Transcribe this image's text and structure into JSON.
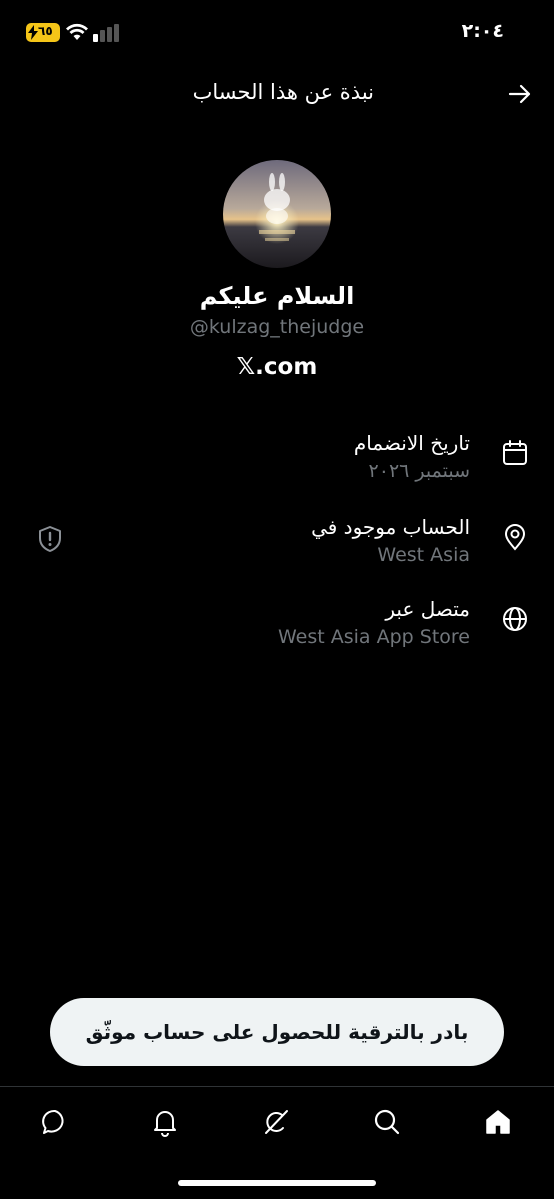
{
  "status_bar": {
    "time": "٢:٠٤",
    "battery_level": "٦٥"
  },
  "header": {
    "title": "نبذة عن هذا الحساب",
    "back_icon": "arrow-right-icon"
  },
  "profile": {
    "display_name": "السلام عليكم",
    "handle": "@kulzag_thejudge",
    "website": "𝕏.com"
  },
  "info": [
    {
      "label": "تاريخ الانضمام",
      "value": "سبتمبر ٢٠٢٦",
      "icon": "calendar-icon"
    },
    {
      "label": "الحساب موجود في",
      "value": "West Asia",
      "icon": "location-pin-icon"
    },
    {
      "label": "متصل عبر",
      "value": "West Asia App Store",
      "icon": "globe-icon"
    }
  ],
  "upgrade": {
    "label": "بادر بالترقية للحصول على حساب موثّق"
  },
  "nav": [
    "messages-icon",
    "notifications-icon",
    "grok-icon",
    "search-icon",
    "home-icon"
  ],
  "colors": {
    "background": "#000000",
    "text_primary": "#ffffff",
    "text_secondary": "#71767b",
    "button_bg": "#eff3f4",
    "battery": "#f5c518"
  }
}
